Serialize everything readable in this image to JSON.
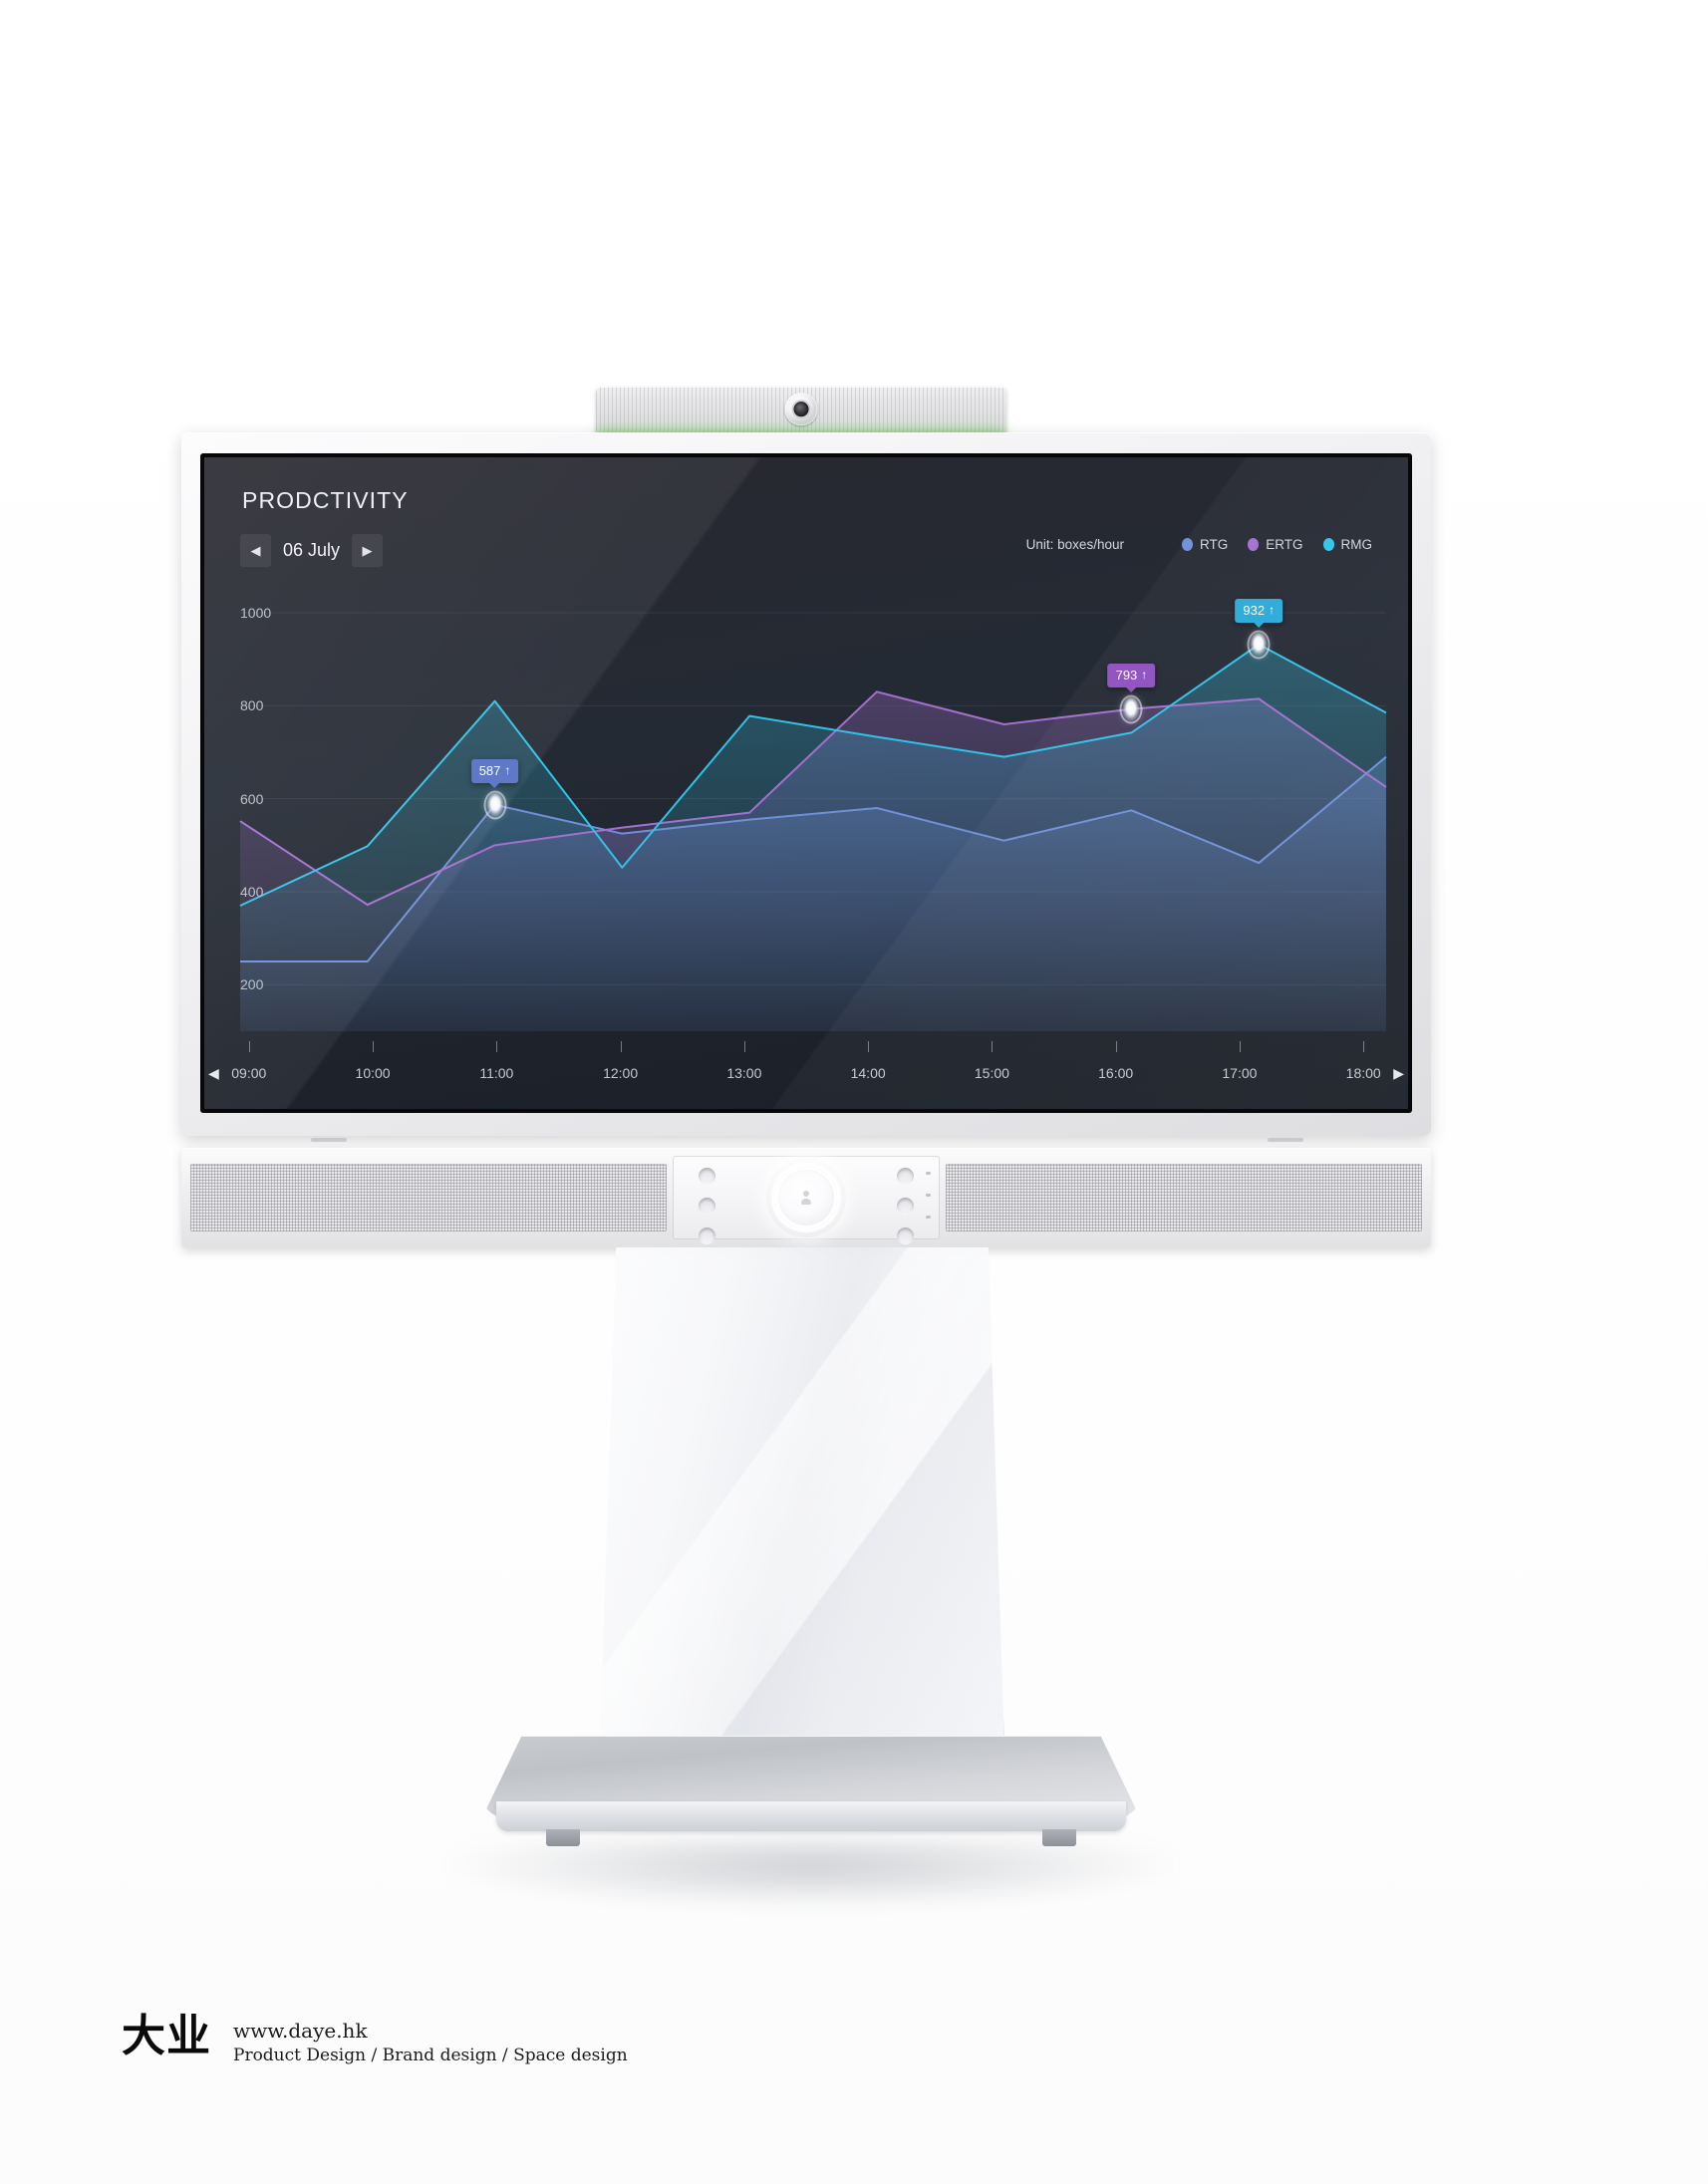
{
  "device": {
    "camera": {
      "lens_label": "camera-lens",
      "led_color": "#32d400"
    },
    "soundbar": {
      "control_label": "person-button"
    }
  },
  "screen": {
    "title": "PRODCTIVITY",
    "date_nav": {
      "prev_icon": "◀",
      "next_icon": "▶",
      "value": "06 July"
    },
    "unit_label": "Unit: boxes/hour",
    "legend": [
      {
        "label": "RTG",
        "color": "#6f8fd8"
      },
      {
        "label": "ERTG",
        "color": "#a46fcf"
      },
      {
        "label": "RMG",
        "color": "#2fc3e8"
      }
    ],
    "x_nav": {
      "left_icon": "◀",
      "right_icon": "▶"
    },
    "tooltips": [
      {
        "value": "587",
        "trend_icon": "↑",
        "series": "RTG",
        "color": "#5570c4",
        "x_time": "11:00"
      },
      {
        "value": "793",
        "trend_icon": "↑",
        "series": "ERTG",
        "color": "#8e4fc0",
        "x_time": "16:00"
      },
      {
        "value": "932",
        "trend_icon": "↑",
        "series": "RMG",
        "color": "#2aa9d8",
        "x_time": "17:00"
      }
    ]
  },
  "chart_data": {
    "type": "line",
    "title": "PRODCTIVITY",
    "xlabel": "",
    "ylabel": "boxes/hour",
    "unit": "boxes/hour",
    "categories": [
      "09:00",
      "10:00",
      "11:00",
      "12:00",
      "13:00",
      "14:00",
      "15:00",
      "16:00",
      "17:00",
      "18:00"
    ],
    "ylim": [
      100,
      1060
    ],
    "yticks": [
      200,
      400,
      600,
      800,
      1000
    ],
    "grid": true,
    "legend_position": "top-right",
    "series": [
      {
        "name": "RTG",
        "color": "#6f8fd8",
        "values": [
          250,
          250,
          587,
          525,
          555,
          580,
          510,
          575,
          462,
          690
        ]
      },
      {
        "name": "ERTG",
        "color": "#a46fcf",
        "values": [
          552,
          372,
          500,
          538,
          570,
          830,
          760,
          793,
          815,
          625
        ]
      },
      {
        "name": "RMG",
        "color": "#2fc3e8",
        "values": [
          370,
          498,
          810,
          452,
          778,
          733,
          690,
          742,
          932,
          785
        ]
      }
    ]
  },
  "footer": {
    "logo": "大业",
    "url": "www.daye.hk",
    "tagline": "Product Design  /  Brand design  /  Space design"
  }
}
